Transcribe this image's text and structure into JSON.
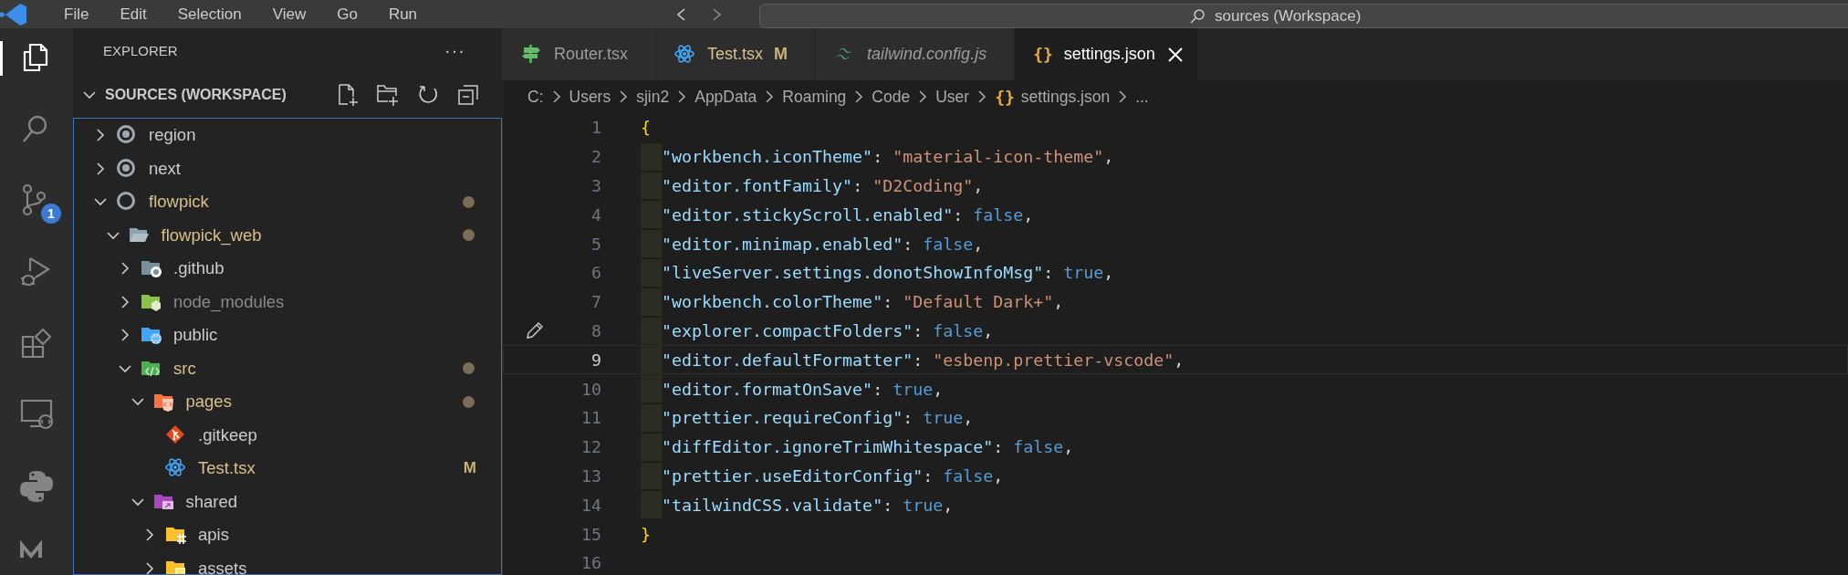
{
  "title_bar": {
    "menu": [
      "File",
      "Edit",
      "Selection",
      "View",
      "Go",
      "Run"
    ],
    "search": "sources (Workspace)"
  },
  "activity_bar": [
    {
      "kind": "files",
      "selected": true
    },
    {
      "kind": "search",
      "selected": false
    },
    {
      "kind": "source-control",
      "selected": false,
      "badge": "1"
    },
    {
      "kind": "run-debug",
      "selected": false
    },
    {
      "kind": "extensions",
      "selected": false
    },
    {
      "kind": "remote",
      "selected": false
    },
    {
      "kind": "python",
      "selected": false
    },
    {
      "kind": "partial",
      "selected": false
    }
  ],
  "explorer": {
    "title": "EXPLORER",
    "more": "···",
    "section": "SOURCES (WORKSPACE)",
    "tree": [
      {
        "label": "region",
        "kind": "root-filled",
        "expanded": false,
        "modified": false,
        "dimmed": false
      },
      {
        "label": "next",
        "kind": "root-filled",
        "expanded": false,
        "modified": false,
        "dimmed": false
      },
      {
        "label": "flowpick",
        "kind": "root",
        "expanded": true,
        "modified": true,
        "dimmed": false,
        "children": [
          {
            "label": "flowpick_web",
            "kind": "folder-open",
            "expanded": true,
            "modified": true,
            "dimmed": false,
            "children": [
              {
                "label": ".github",
                "kind": "folder-github",
                "expanded": false,
                "modified": false,
                "dimmed": false
              },
              {
                "label": "node_modules",
                "kind": "folder-node",
                "expanded": false,
                "modified": false,
                "dimmed": true
              },
              {
                "label": "public",
                "kind": "folder-public",
                "expanded": false,
                "modified": false,
                "dimmed": false
              },
              {
                "label": "src",
                "kind": "folder-src",
                "expanded": true,
                "modified": true,
                "dimmed": false,
                "children": [
                  {
                    "label": "pages",
                    "kind": "folder-pages",
                    "expanded": true,
                    "modified": true,
                    "dimmed": false,
                    "children": [
                      {
                        "label": ".gitkeep",
                        "kind": "git",
                        "modified": false,
                        "dimmed": false
                      },
                      {
                        "label": "Test.tsx",
                        "kind": "react",
                        "modified": true,
                        "dimmed": false,
                        "badge": "M"
                      }
                    ]
                  },
                  {
                    "label": "shared",
                    "kind": "folder-shared",
                    "expanded": true,
                    "modified": false,
                    "dimmed": false,
                    "children": [
                      {
                        "label": "apis",
                        "kind": "folder-apis",
                        "expanded": false,
                        "modified": false,
                        "dimmed": false
                      },
                      {
                        "label": "assets",
                        "kind": "folder-assets",
                        "expanded": false,
                        "modified": false,
                        "dimmed": false
                      }
                    ]
                  }
                ]
              }
            ]
          }
        ]
      }
    ]
  },
  "tabs": [
    {
      "label": "Router.tsx",
      "kind": "signpost",
      "selected": false,
      "preview": false,
      "modified": false
    },
    {
      "label": "Test.tsx",
      "kind": "react",
      "selected": false,
      "preview": false,
      "modified": true,
      "badge": "M"
    },
    {
      "label": "tailwind.config.js",
      "kind": "tailwind",
      "selected": false,
      "preview": true,
      "modified": false
    },
    {
      "label": "settings.json",
      "kind": "json",
      "glyph": "{}",
      "selected": true,
      "preview": false,
      "modified": false
    }
  ],
  "breadcrumb": [
    {
      "label": "C:"
    },
    {
      "label": "Users"
    },
    {
      "label": "sjin2"
    },
    {
      "label": "AppData"
    },
    {
      "label": "Roaming"
    },
    {
      "label": "Code"
    },
    {
      "label": "User"
    },
    {
      "label": "settings.json",
      "glyph": "{}"
    },
    {
      "label": "..."
    }
  ],
  "code": [
    {
      "number": "1",
      "indented": false,
      "current": false,
      "edited": false,
      "tokens": [
        {
          "kind": "brace",
          "text": "{"
        }
      ]
    },
    {
      "number": "2",
      "indented": true,
      "current": false,
      "edited": false,
      "tokens": [
        {
          "kind": "key",
          "text": "\"workbench.iconTheme\""
        },
        {
          "kind": "punct",
          "text": ": "
        },
        {
          "kind": "string",
          "text": "\"material-icon-theme\""
        },
        {
          "kind": "punct",
          "text": ","
        }
      ]
    },
    {
      "number": "3",
      "indented": true,
      "current": false,
      "edited": false,
      "tokens": [
        {
          "kind": "key",
          "text": "\"editor.fontFamily\""
        },
        {
          "kind": "punct",
          "text": ": "
        },
        {
          "kind": "string",
          "text": "\"D2Coding\""
        },
        {
          "kind": "punct",
          "text": ","
        }
      ]
    },
    {
      "number": "4",
      "indented": true,
      "current": false,
      "edited": false,
      "tokens": [
        {
          "kind": "key",
          "text": "\"editor.stickyScroll.enabled\""
        },
        {
          "kind": "punct",
          "text": ": "
        },
        {
          "kind": "keyword",
          "text": "false"
        },
        {
          "kind": "punct",
          "text": ","
        }
      ]
    },
    {
      "number": "5",
      "indented": true,
      "current": false,
      "edited": false,
      "tokens": [
        {
          "kind": "key",
          "text": "\"editor.minimap.enabled\""
        },
        {
          "kind": "punct",
          "text": ": "
        },
        {
          "kind": "keyword",
          "text": "false"
        },
        {
          "kind": "punct",
          "text": ","
        }
      ]
    },
    {
      "number": "6",
      "indented": true,
      "current": false,
      "edited": false,
      "tokens": [
        {
          "kind": "key",
          "text": "\"liveServer.settings.donotShowInfoMsg\""
        },
        {
          "kind": "punct",
          "text": ": "
        },
        {
          "kind": "keyword",
          "text": "true"
        },
        {
          "kind": "punct",
          "text": ","
        }
      ]
    },
    {
      "number": "7",
      "indented": true,
      "current": false,
      "edited": false,
      "tokens": [
        {
          "kind": "key",
          "text": "\"workbench.colorTheme\""
        },
        {
          "kind": "punct",
          "text": ": "
        },
        {
          "kind": "string",
          "text": "\"Default Dark+\""
        },
        {
          "kind": "punct",
          "text": ","
        }
      ]
    },
    {
      "number": "8",
      "indented": true,
      "current": false,
      "edited": true,
      "tokens": [
        {
          "kind": "key",
          "text": "\"explorer.compactFolders\""
        },
        {
          "kind": "punct",
          "text": ": "
        },
        {
          "kind": "keyword",
          "text": "false"
        },
        {
          "kind": "punct",
          "text": ","
        }
      ]
    },
    {
      "number": "9",
      "indented": true,
      "current": true,
      "edited": false,
      "tokens": [
        {
          "kind": "key",
          "text": "\"editor.defaultFormatter\""
        },
        {
          "kind": "punct",
          "text": ": "
        },
        {
          "kind": "string",
          "text": "\"esbenp.prettier-vscode\""
        },
        {
          "kind": "punct",
          "text": ","
        }
      ]
    },
    {
      "number": "10",
      "indented": true,
      "current": false,
      "edited": false,
      "tokens": [
        {
          "kind": "key",
          "text": "\"editor.formatOnSave\""
        },
        {
          "kind": "punct",
          "text": ": "
        },
        {
          "kind": "keyword",
          "text": "true"
        },
        {
          "kind": "punct",
          "text": ","
        }
      ]
    },
    {
      "number": "11",
      "indented": true,
      "current": false,
      "edited": false,
      "tokens": [
        {
          "kind": "key",
          "text": "\"prettier.requireConfig\""
        },
        {
          "kind": "punct",
          "text": ": "
        },
        {
          "kind": "keyword",
          "text": "true"
        },
        {
          "kind": "punct",
          "text": ","
        }
      ]
    },
    {
      "number": "12",
      "indented": true,
      "current": false,
      "edited": false,
      "tokens": [
        {
          "kind": "key",
          "text": "\"diffEditor.ignoreTrimWhitespace\""
        },
        {
          "kind": "punct",
          "text": ": "
        },
        {
          "kind": "keyword",
          "text": "false"
        },
        {
          "kind": "punct",
          "text": ","
        }
      ]
    },
    {
      "number": "13",
      "indented": true,
      "current": false,
      "edited": false,
      "tokens": [
        {
          "kind": "key",
          "text": "\"prettier.useEditorConfig\""
        },
        {
          "kind": "punct",
          "text": ": "
        },
        {
          "kind": "keyword",
          "text": "false"
        },
        {
          "kind": "punct",
          "text": ","
        }
      ]
    },
    {
      "number": "14",
      "indented": true,
      "current": false,
      "edited": false,
      "tokens": [
        {
          "kind": "key",
          "text": "\"tailwindCSS.validate\""
        },
        {
          "kind": "punct",
          "text": ": "
        },
        {
          "kind": "keyword",
          "text": "true"
        },
        {
          "kind": "punct",
          "text": ","
        }
      ]
    },
    {
      "number": "15",
      "indented": false,
      "current": false,
      "edited": false,
      "tokens": [
        {
          "kind": "brace",
          "text": "}"
        }
      ]
    },
    {
      "number": "16",
      "indented": false,
      "current": false,
      "edited": false
    }
  ]
}
